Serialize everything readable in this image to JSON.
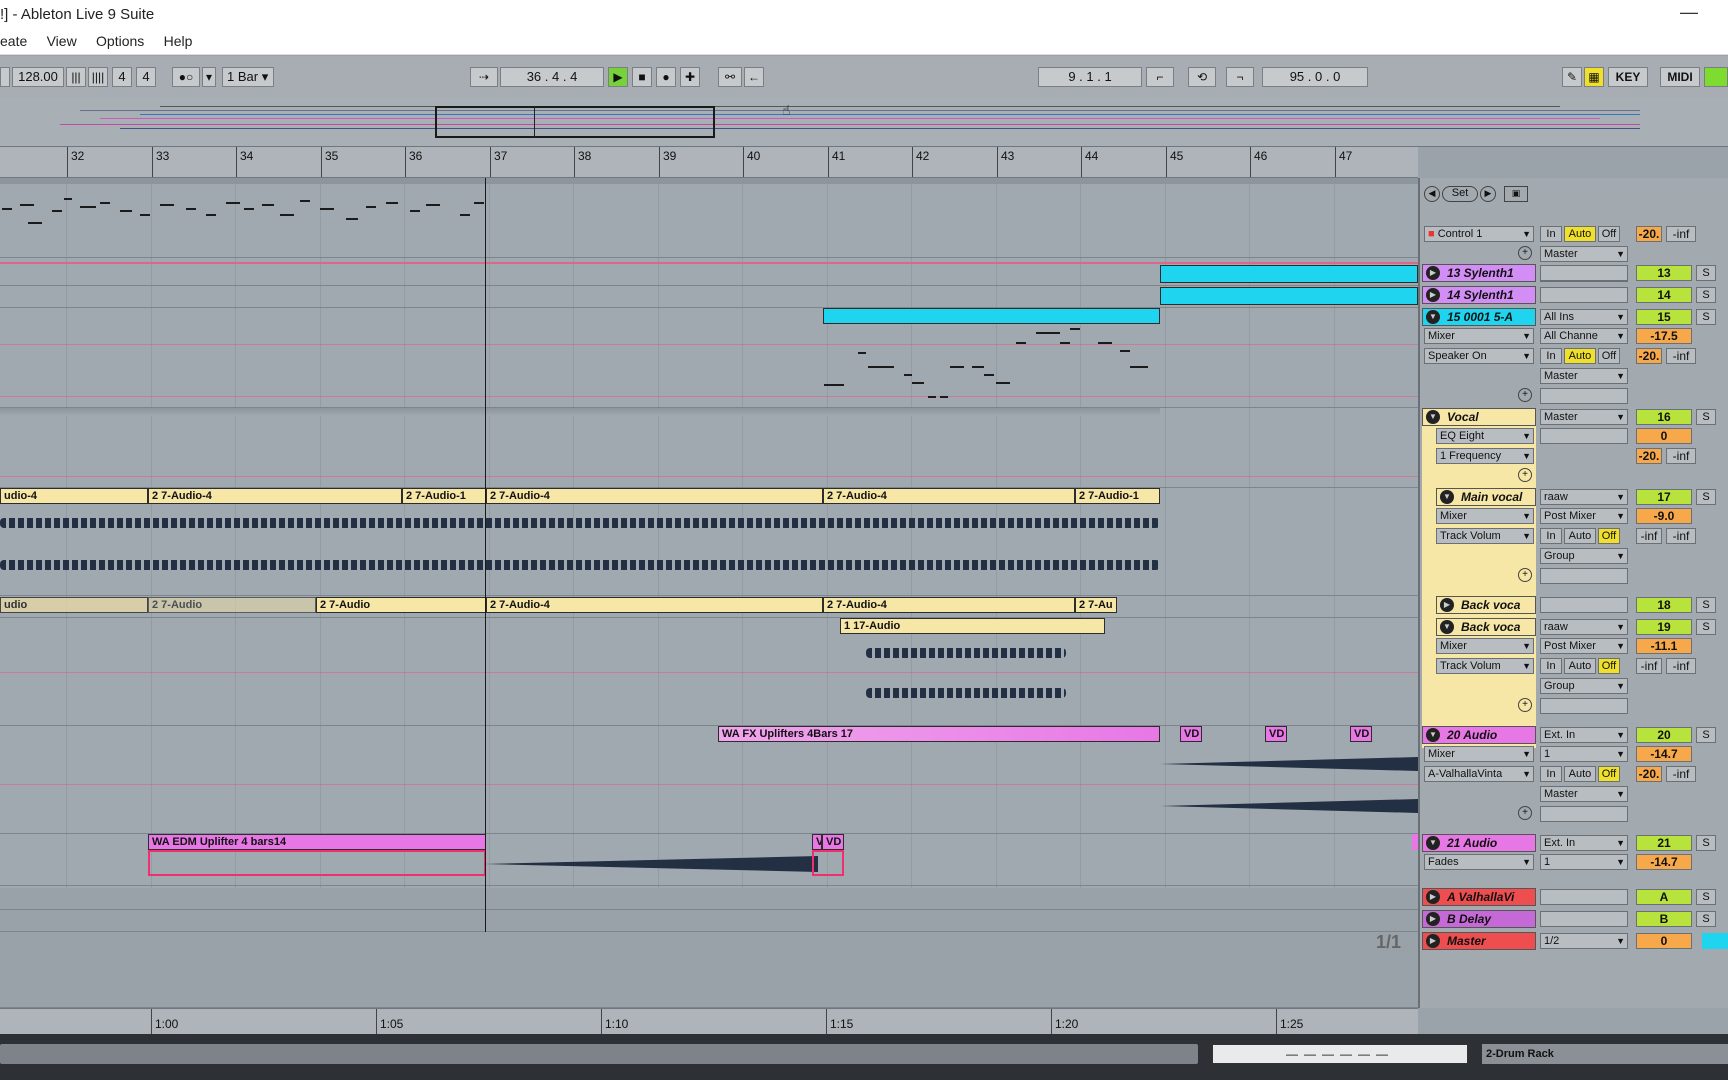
{
  "window": {
    "title": "!] - Ableton Live 9 Suite",
    "minimize": "—"
  },
  "menu": [
    "eate",
    "View",
    "Options",
    "Help"
  ],
  "transport": {
    "tempo": "128.00",
    "signature_num": "4",
    "signature_den": "4",
    "quantize": "1 Bar",
    "position": "36 .  4 .  4",
    "loop_start": "9 .  1 .  1",
    "loop_length": "95 .  0 .  0",
    "key_label": "KEY",
    "midi_label": "MIDI"
  },
  "ruler": {
    "bars": [
      "32",
      "33",
      "34",
      "35",
      "36",
      "37",
      "38",
      "39",
      "40",
      "41",
      "42",
      "43",
      "44",
      "45",
      "46",
      "47"
    ]
  },
  "time_ruler": {
    "times": [
      "1:00",
      "1:05",
      "1:10",
      "1:15",
      "1:20",
      "1:25"
    ],
    "page": "1/1"
  },
  "clips": {
    "sylenth13": "",
    "sylenth14": "",
    "t15": "",
    "a1": "udio-4",
    "a2": "2 7-Audio-4",
    "a3": "2 7-Audio-1",
    "a4": "2 7-Audio-4",
    "a5": "2 7-Audio-4",
    "a6": "2 7-Audio-1",
    "b1": "udio",
    "b2": "2 7-Audio",
    "b3": "2 7-Audio",
    "b4": "2 7-Audio-4",
    "b5": "2 7-Audio-4",
    "b6": "2 7-Au",
    "c1": "1 17-Audio",
    "fx": "WA FX Uplifters 4Bars 17",
    "vd": "VD",
    "edm": "WA EDM Uplifter 4 bars14"
  },
  "mixer": {
    "set_label": "Set",
    "control": "Control 1",
    "in": "In",
    "auto": "Auto",
    "off": "Off",
    "master": "Master",
    "group": "Group",
    "tracks": [
      {
        "name": "13 Sylenth1",
        "num": "13",
        "s": "S"
      },
      {
        "name": "14 Sylenth1",
        "num": "14",
        "s": "S"
      },
      {
        "name": "15 0001 5-A",
        "num": "15",
        "s": "S"
      },
      {
        "name": "Vocal",
        "num": "16",
        "s": "S"
      },
      {
        "name": "Main vocal",
        "num": "17",
        "s": "S"
      },
      {
        "name": "Back voca",
        "num": "18",
        "s": "S"
      },
      {
        "name": "Back voca",
        "num": "19",
        "s": "S"
      },
      {
        "name": "20 Audio",
        "num": "20",
        "s": "S"
      },
      {
        "name": "21 Audio",
        "num": "21",
        "s": "S"
      },
      {
        "name": "A ValhallaVi",
        "num": "A",
        "s": "S"
      },
      {
        "name": "B Delay",
        "num": "B",
        "s": "S"
      },
      {
        "name": "Master",
        "num": "0",
        "s": ""
      }
    ],
    "vals": {
      "v0": "-20.",
      "inf": "-inf",
      "t15_in": "All Ins",
      "t15_mixer": "Mixer",
      "t15_ch": "All Channe",
      "t15_vol": "-17.5",
      "t15_spk": "Speaker On",
      "t15_db": "-20.",
      "vocal_out": "Master",
      "eq": "EQ Eight",
      "freq": "1 Frequency",
      "vocal_vol": "0",
      "vocal_db": "-20.",
      "mv_in": "raaw",
      "mv_mixer": "Mixer",
      "mv_post": "Post Mixer",
      "mv_vol": "-9.0",
      "mv_tv": "Track Volum",
      "bv_in": "raaw",
      "bv_mixer": "Mixer",
      "bv_post": "Post Mixer",
      "bv_vol": "-11.1",
      "bv_tv": "Track Volum",
      "a20_in": "Ext. In",
      "a20_mixer": "Mixer",
      "a20_ch": "1",
      "a20_vol": "-14.7",
      "a20_dev": "A-ValhallaVinta",
      "a20_db": "-20.",
      "a21_in": "Ext. In",
      "a21_fades": "Fades",
      "a21_ch": "1",
      "a21_vol": "-14.7",
      "master_out": "1/2"
    }
  },
  "status": {
    "drum_rack": "2-Drum Rack"
  },
  "colors": {
    "cyan": "#1fd4ee",
    "yellow": "#f7e7a6",
    "magenta": "#e877e6",
    "green": "#b8e23c",
    "orange": "#f7a84a",
    "red": "#ef4e50"
  }
}
